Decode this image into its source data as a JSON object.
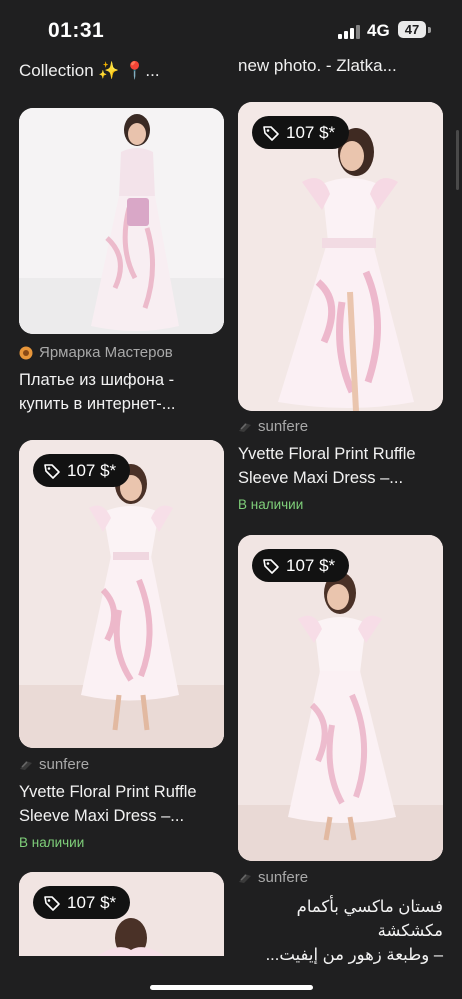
{
  "status_bar": {
    "time": "01:31",
    "network": "4G",
    "battery": "47"
  },
  "top_fragments": {
    "left": "Collection ✨ 📍...",
    "right": "new photo. - Zlatka..."
  },
  "cards": [
    {
      "id": "c1",
      "price": "",
      "source_name": "Ярмарка Мастеров",
      "title_line1": "Платье из шифона -",
      "title_line2": "купить в интернет-...",
      "stock": ""
    },
    {
      "id": "c2",
      "price": "107 $*",
      "source_name": "sunfere",
      "title_line1": "Yvette Floral Print Ruffle",
      "title_line2": "Sleeve Maxi Dress –...",
      "stock": "В наличии"
    },
    {
      "id": "c3",
      "price": "107 $*",
      "source_name": "sunfere",
      "title_line1": "Yvette Floral Print Ruffle",
      "title_line2": "Sleeve Maxi Dress –...",
      "stock": "В наличии"
    },
    {
      "id": "c4",
      "price": "107 $*",
      "source_name": "sunfere",
      "title_line1": "فستان ماكسي بأكمام مكشكشة",
      "title_line2": "– وطبعة زهور من إيفيت...",
      "stock": ""
    },
    {
      "id": "c5",
      "price": "107 $*",
      "source_name": "",
      "title_line1": "",
      "title_line2": "",
      "stock": ""
    }
  ],
  "colors": {
    "background": "#1f1f20",
    "stock_green": "#7fcf7a",
    "price_chip": "#121212"
  },
  "icons": [
    "tag-icon",
    "sunflower-icon",
    "sunfere-logo-icon",
    "signal-icon",
    "battery-icon"
  ]
}
